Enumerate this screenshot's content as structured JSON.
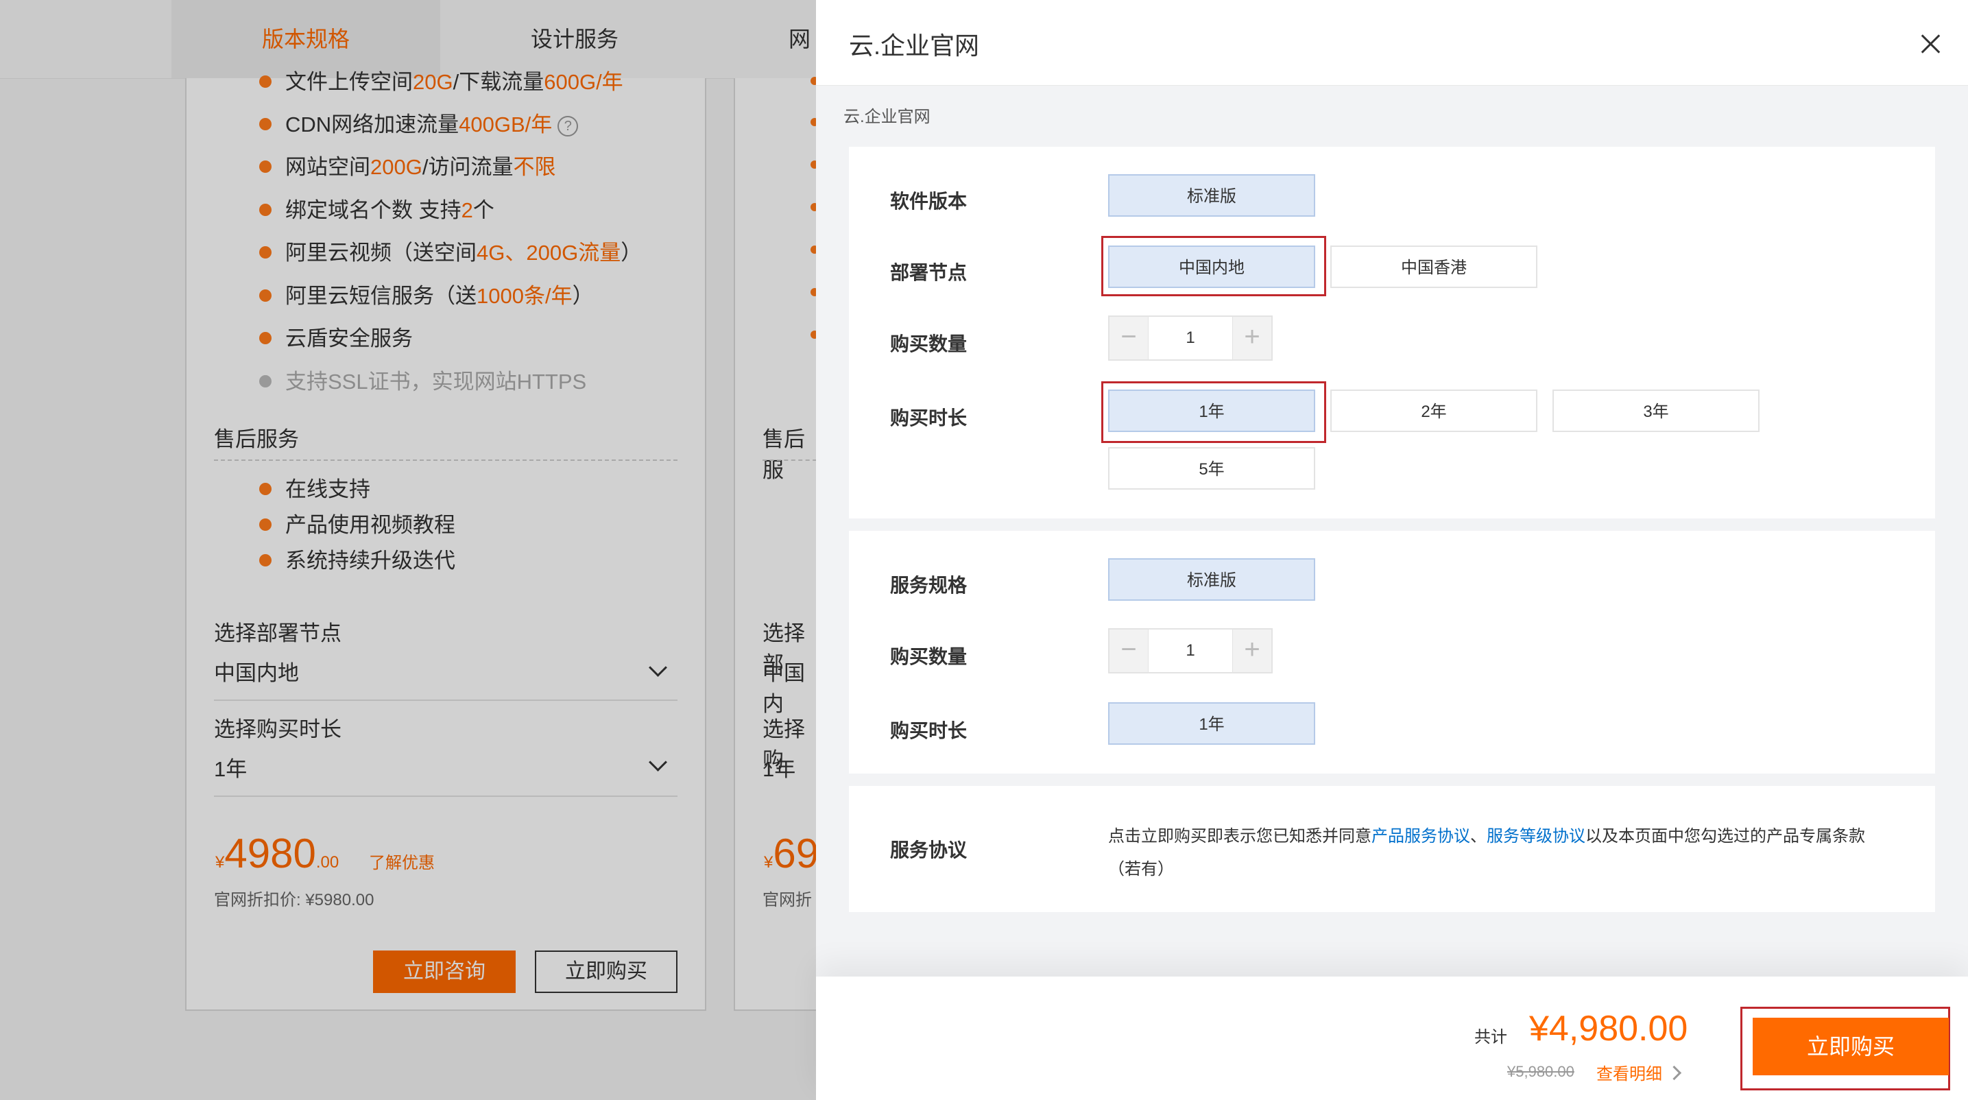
{
  "background": {
    "tabs": [
      "版本规格",
      "设计服务",
      "网"
    ],
    "card1": {
      "features": [
        {
          "pre": "文件上传空间",
          "hl": "20G",
          "mid": "/下载流量",
          "hl2": "600G/年",
          "post": ""
        },
        {
          "pre": "CDN网络加速流量",
          "hl": "400GB/年",
          "mid": "",
          "hl2": "",
          "post": ""
        },
        {
          "pre": "网站空间",
          "hl": "200G",
          "mid": "/访问流量",
          "hl2": "不限",
          "post": ""
        },
        {
          "pre": "绑定域名个数 支持",
          "hl": "2",
          "mid": "个",
          "hl2": "",
          "post": ""
        },
        {
          "pre": "阿里云视频（送空间",
          "hl": "4G、200G流量",
          "mid": "）",
          "hl2": "",
          "post": ""
        },
        {
          "pre": "阿里云短信服务（送",
          "hl": "1000条/年",
          "mid": "）",
          "hl2": "",
          "post": ""
        },
        {
          "pre": "云盾安全服务",
          "hl": "",
          "mid": "",
          "hl2": "",
          "post": ""
        }
      ],
      "feature_muted": "支持SSL证书，实现网站HTTPS",
      "aftersale_title": "售后服务",
      "aftersale_items": [
        "在线支持",
        "产品使用视频教程",
        "系统持续升级迭代"
      ],
      "node_label": "选择部署节点",
      "node_value": "中国内地",
      "duration_label": "选择购买时长",
      "duration_value": "1年",
      "price_symbol": "¥",
      "price_int": "4980",
      "price_dec": ".00",
      "discount_link": "了解优惠",
      "official_price": "官网折扣价: ¥5980.00",
      "consult_button": "立即咨询",
      "buy_button": "立即购买"
    },
    "card2": {
      "aftersale_title": "售后服",
      "node_label": "选择部",
      "node_value": "中国内",
      "duration_label": "选择购",
      "duration_value": "1年",
      "price_symbol": "¥",
      "price_int": "69",
      "official_price": "官网折"
    }
  },
  "drawer": {
    "title": "云.企业官网",
    "breadcrumb": "云.企业官网",
    "section1": {
      "software_version": {
        "label": "软件版本",
        "options": [
          "标准版"
        ]
      },
      "deploy_node": {
        "label": "部署节点",
        "options": [
          "中国内地",
          "中国香港"
        ]
      },
      "quantity": {
        "label": "购买数量",
        "value": "1",
        "minus": "−",
        "plus": "+"
      },
      "duration": {
        "label": "购买时长",
        "options": [
          "1年",
          "2年",
          "3年",
          "5年"
        ]
      }
    },
    "section2": {
      "service_spec": {
        "label": "服务规格",
        "options": [
          "标准版"
        ]
      },
      "quantity": {
        "label": "购买数量",
        "value": "1",
        "minus": "−",
        "plus": "+"
      },
      "duration": {
        "label": "购买时长",
        "options": [
          "1年"
        ]
      }
    },
    "agreement": {
      "label": "服务协议",
      "text_pre": "点击立即购买即表示您已知悉并同意",
      "link1": "产品服务协议",
      "sep": "、",
      "link2": "服务等级协议",
      "text_post": "以及本页面中您勾选过的产品专属条款（若有）"
    },
    "footer": {
      "total_label": "共计",
      "total_price": "¥4,980.00",
      "original_price": "¥5,980.00",
      "detail_link": "查看明细",
      "buy_button": "立即购买"
    }
  }
}
